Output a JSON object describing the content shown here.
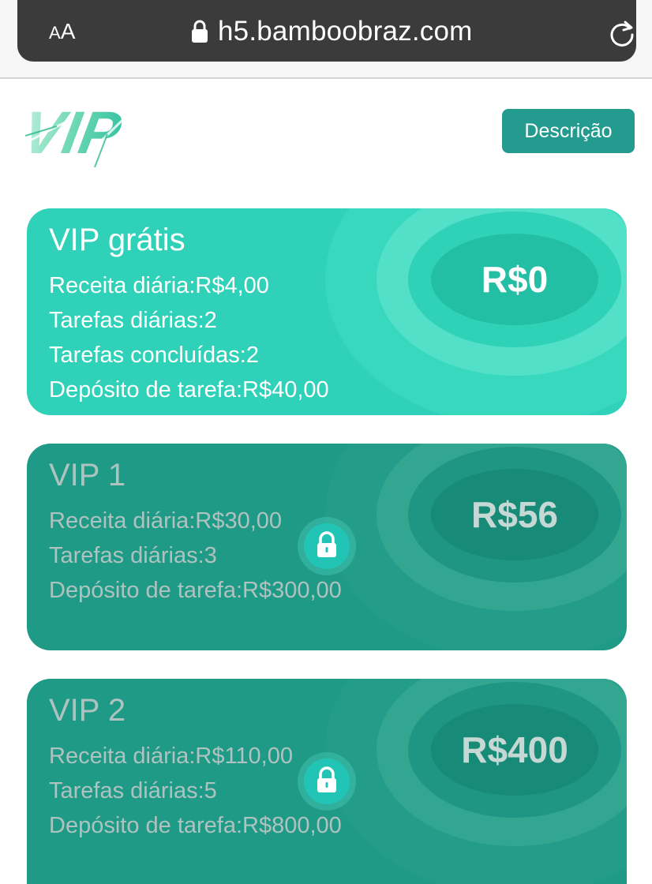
{
  "browser": {
    "aa_big": "A",
    "aa_small": "A",
    "url": "h5.bamboobraz.com",
    "lock_icon": "lock-icon",
    "reload_icon": "reload-icon"
  },
  "header": {
    "logo_text": "VIP",
    "description_button": "Descrição"
  },
  "colors": {
    "accent": "#239c8f",
    "free_card": "#2fd2b8",
    "locked_card": "#1f9a86"
  },
  "cards": [
    {
      "title": "VIP grátis",
      "price": "R$0",
      "locked": false,
      "lines": [
        "Receita diária:R$4,00",
        "Tarefas diárias:2",
        "Tarefas concluídas:2",
        "Depósito de tarefa:R$40,00"
      ]
    },
    {
      "title": "VIP 1",
      "price": "R$56",
      "locked": true,
      "lines": [
        "Receita diária:R$30,00",
        "Tarefas diárias:3",
        "Depósito de tarefa:R$300,00"
      ]
    },
    {
      "title": "VIP 2",
      "price": "R$400",
      "locked": true,
      "lines": [
        "Receita diária:R$110,00",
        "Tarefas diárias:5",
        "Depósito de tarefa:R$800,00"
      ]
    }
  ]
}
